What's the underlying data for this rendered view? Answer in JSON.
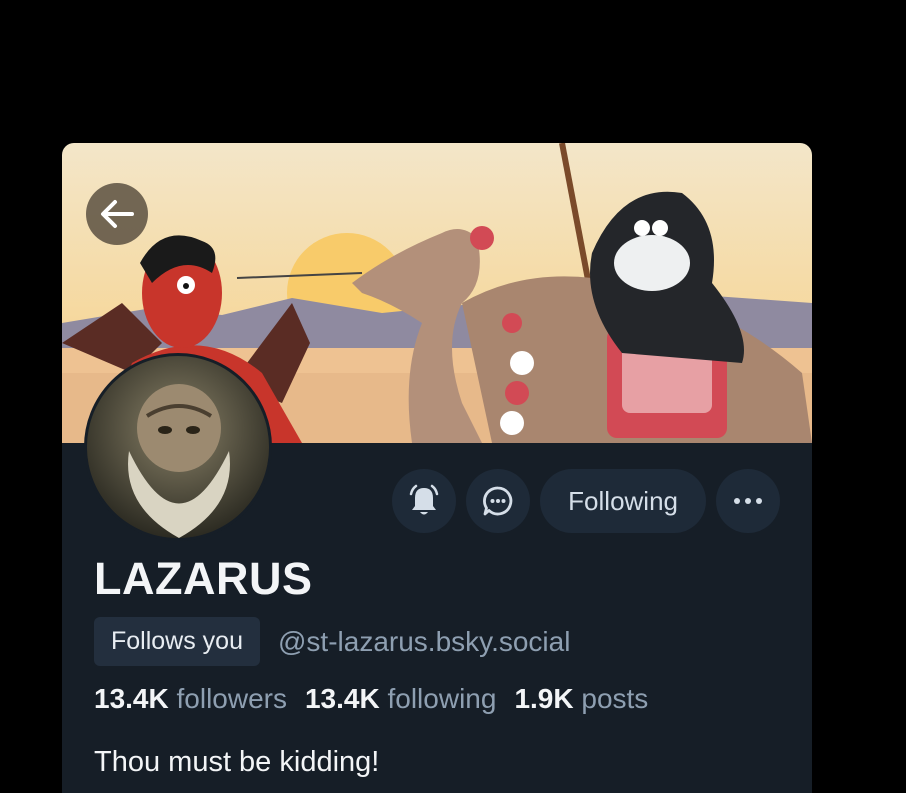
{
  "profile": {
    "display_name": "LAZARUS",
    "handle": "@st-lazarus.bsky.social",
    "follows_you_label": "Follows you",
    "bio": "Thou must be kidding!"
  },
  "stats": {
    "followers": {
      "count": "13.4K",
      "label": "followers"
    },
    "following": {
      "count": "13.4K",
      "label": "following"
    },
    "posts": {
      "count": "1.9K",
      "label": "posts"
    }
  },
  "actions": {
    "following_label": "Following",
    "notify_icon": "bell-icon",
    "message_icon": "chat-bubble-icon",
    "more_icon": "more-horizontal-icon"
  },
  "icons": {
    "back": "arrow-left-icon"
  },
  "colors": {
    "background": "#000000",
    "card": "#161e27",
    "button": "#1e2a38",
    "muted_text": "#8e9fb1",
    "primary_text": "#f3f5f7"
  }
}
